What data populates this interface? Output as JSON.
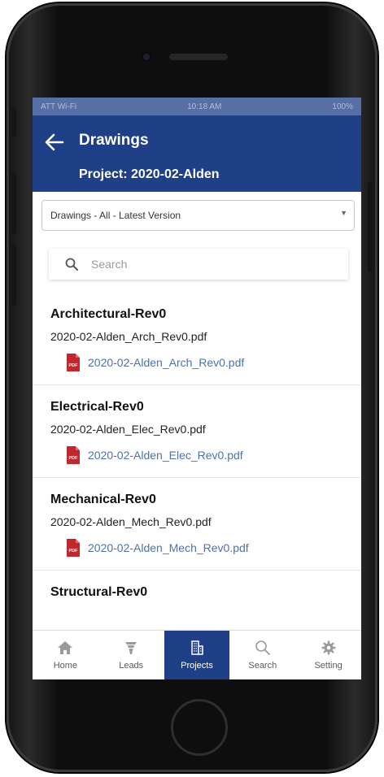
{
  "status_bar": {
    "carrier": "ATT Wi-Fi",
    "time": "10:18 AM",
    "battery": "100%"
  },
  "header": {
    "title": "Drawings",
    "project": "Project: 2020-02-Alden"
  },
  "filter": {
    "selected": "Drawings - All - Latest Version"
  },
  "search": {
    "placeholder": "Search"
  },
  "sections": [
    {
      "title": "Architectural-Rev0",
      "file": "2020-02-Alden_Arch_Rev0.pdf",
      "link": "2020-02-Alden_Arch_Rev0.pdf"
    },
    {
      "title": "Electrical-Rev0",
      "file": "2020-02-Alden_Elec_Rev0.pdf",
      "link": "2020-02-Alden_Elec_Rev0.pdf"
    },
    {
      "title": "Mechanical-Rev0",
      "file": "2020-02-Alden_Mech_Rev0.pdf",
      "link": "2020-02-Alden_Mech_Rev0.pdf"
    },
    {
      "title": "Structural-Rev0"
    }
  ],
  "nav": [
    {
      "label": "Home",
      "icon": "home-icon"
    },
    {
      "label": "Leads",
      "icon": "funnel-icon"
    },
    {
      "label": "Projects",
      "icon": "building-icon",
      "active": true
    },
    {
      "label": "Search",
      "icon": "search-icon"
    },
    {
      "label": "Setting",
      "icon": "gear-icon"
    }
  ],
  "colors": {
    "primary": "#1f3f87",
    "link": "#4f71a8",
    "pdf": "#c0282d"
  }
}
